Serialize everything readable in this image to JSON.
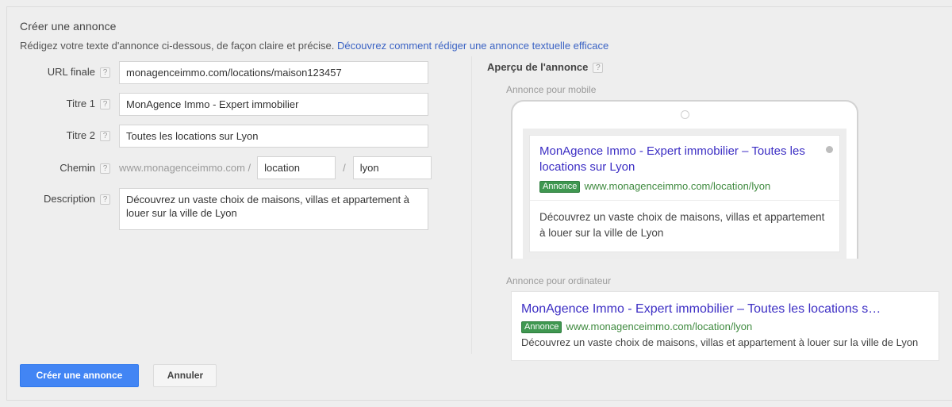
{
  "header": {
    "title": "Créer une annonce",
    "subtitle_text": "Rédigez votre texte d'annonce ci-dessous, de façon claire et précise.",
    "subtitle_link": "Découvrez comment rédiger une annonce textuelle efficace"
  },
  "help_icon": "?",
  "form": {
    "url_label": "URL finale",
    "url_value": "monagenceimmo.com/locations/maison123457",
    "title1_label": "Titre 1",
    "title1_value": "MonAgence Immo - Expert immobilier",
    "title2_label": "Titre 2",
    "title2_value": "Toutes les locations sur Lyon",
    "path_label": "Chemin",
    "path_domain": "www.monagenceimmo.com /",
    "path1_value": "location",
    "path2_value": "lyon",
    "path_separator": "/",
    "description_label": "Description",
    "description_value": "Découvrez un vaste choix de maisons, villas et appartement à louer sur la ville de Lyon"
  },
  "preview": {
    "heading": "Aperçu de l'annonce",
    "mobile_label": "Annonce pour mobile",
    "desktop_label": "Annonce pour ordinateur",
    "mobile_ad": {
      "title": "MonAgence Immo - Expert immobilier – Toutes les locations sur Lyon",
      "badge": "Annonce",
      "url": "www.monagenceimmo.com/location/lyon",
      "description": "Découvrez un vaste choix de maisons, villas et appartement à louer sur la ville de Lyon"
    },
    "desktop_ad": {
      "title": "MonAgence Immo - Expert immobilier – Toutes les locations s…",
      "badge": "Annonce",
      "url": "www.monagenceimmo.com/location/lyon",
      "description": "Découvrez un vaste choix de maisons, villas et appartement à louer sur la ville de Lyon"
    }
  },
  "footer": {
    "submit_label": "Créer une annonce",
    "cancel_label": "Annuler"
  },
  "colors": {
    "primary_button": "#4285f4",
    "link": "#3b63c4",
    "ad_title": "#3c2ec4",
    "ad_url": "#3f8a3f",
    "ad_badge_bg": "#3f9750"
  }
}
